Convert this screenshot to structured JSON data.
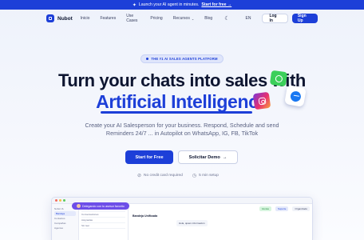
{
  "announcement": {
    "spark_icon": "sparkle-icon",
    "text": "Launch your AI agent in minutes.",
    "cta": "Start for free →"
  },
  "nav": {
    "brand": "Nubot",
    "items": [
      {
        "label": "Inicio"
      },
      {
        "label": "Features"
      },
      {
        "label": "Use Cases"
      },
      {
        "label": "Pricing"
      },
      {
        "label": "Recursos",
        "has_dropdown": true
      },
      {
        "label": "Blog"
      }
    ],
    "language": "EN",
    "login": "Log In",
    "signup": "Sign Up"
  },
  "hero": {
    "badge": "THE #1 AI SALES AGENTS PLATFORM",
    "headline_1": "Turn your chats into sales with",
    "headline_2": "Artificial Intelligence",
    "subtitle": "Create your AI Salesperson for your business. Respond, Schedule and send Reminders 24/7 ... in Autopilot on WhatsApp, IG, FB, TikTok",
    "primary_cta": "Start for Free",
    "secondary_cta": "Solicitar Demo",
    "secondary_arrow": "→",
    "features": [
      {
        "icon": "check-circle-icon",
        "label": "No credit card required"
      },
      {
        "icon": "clock-icon",
        "label": "5 min setup"
      }
    ]
  },
  "preview": {
    "sidebar": [
      {
        "label": "Nubot IA",
        "active": false
      },
      {
        "label": "Bandeja",
        "active": true
      },
      {
        "label": "Contactos",
        "active": false
      },
      {
        "label": "Campañas",
        "active": false
      },
      {
        "label": "Agentes",
        "active": false
      }
    ],
    "list": [
      {
        "label": "Bandeja"
      },
      {
        "label": "Conversaciones"
      },
      {
        "label": "Asignadas"
      },
      {
        "label": "Sin leer"
      }
    ],
    "main_title": "Bandeja Unificada",
    "tags": [
      {
        "label": "Ventas",
        "color": "#d7f5df",
        "text": "#1f8a3a"
      },
      {
        "label": "Soporte",
        "color": "#e4e9fb",
        "text": "#1d3fd8"
      }
    ],
    "status": "Organizado",
    "message": "Hola, quiero información",
    "tooltip": "Delegando con tu asesor favorito"
  },
  "colors": {
    "brand": "#1d3fd8",
    "whatsapp": "#3ccf5a",
    "messenger": "#1877f2"
  }
}
